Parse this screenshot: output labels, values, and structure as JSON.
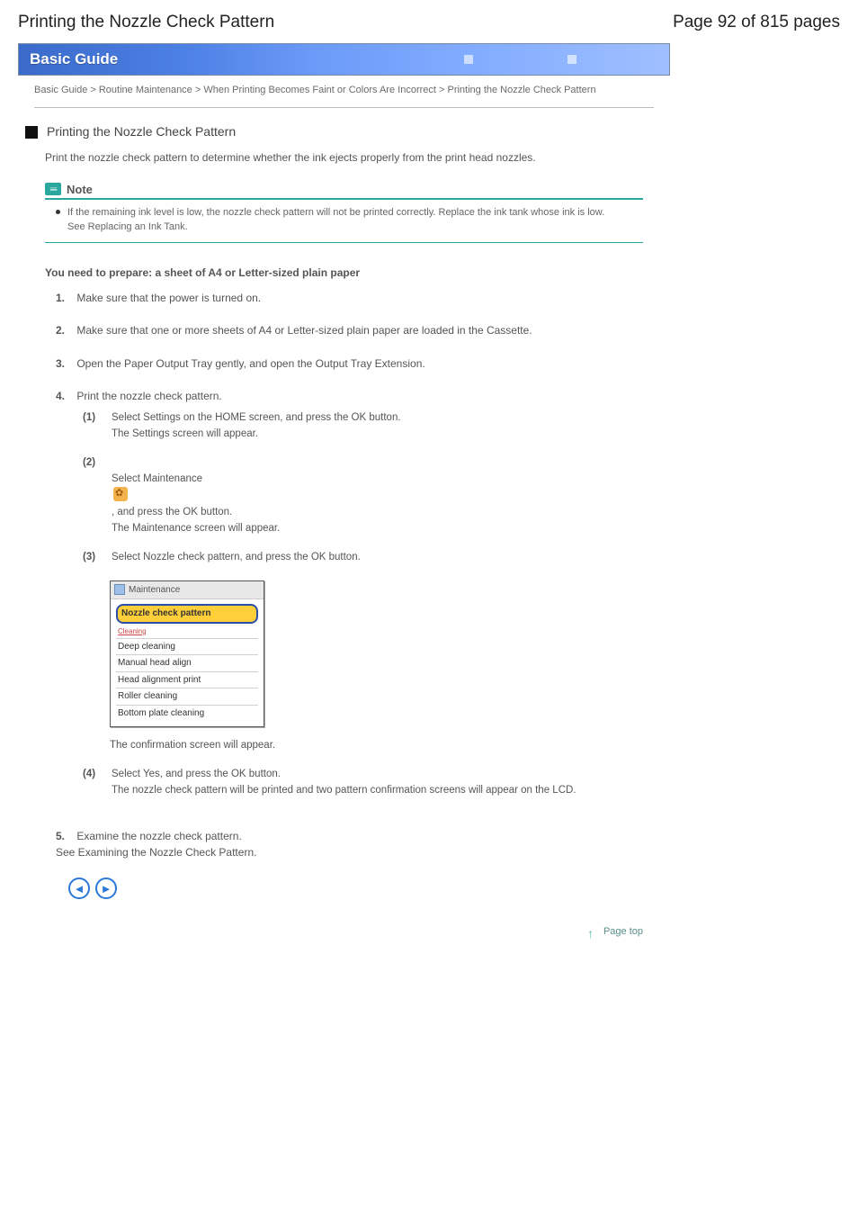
{
  "header": {
    "title_left": "Printing the Nozzle Check Pattern",
    "title_right": "Page 92 of 815 pages"
  },
  "banner": {
    "label": "Basic Guide"
  },
  "breadcrumb": "Basic Guide > Routine Maintenance > When Printing Becomes Faint or Colors Are Incorrect > Printing the Nozzle Check Pattern",
  "heading": "Printing the Nozzle Check Pattern",
  "intro": "Print the nozzle check pattern to determine whether the ink ejects properly from the print head nozzles.",
  "note": {
    "label": "Note",
    "body": "If the remaining ink level is low, the nozzle check pattern will not be printed correctly. Replace the ink tank whose ink is low.\nSee Replacing an Ink Tank."
  },
  "needs": "You need to prepare: a sheet of A4 or Letter-sized plain paper",
  "steps": {
    "s1": {
      "label": "1.",
      "text": "Make sure that the power is turned on."
    },
    "s2": {
      "label": "2.",
      "text": "Make sure that one or more sheets of A4 or Letter-sized plain paper are loaded in the Cassette."
    },
    "s3": {
      "label": "3.",
      "text": "Open the Paper Output Tray gently, and open the Output Tray Extension."
    },
    "s4": {
      "label": "4.",
      "text": "Print the nozzle check pattern.",
      "sub1_p": "(1)",
      "sub1_t": "Select Settings on the HOME screen, and press the OK button.\nThe Settings screen will appear.",
      "sub2_p": "(2)",
      "sub2_t_before": "Select Maintenance ",
      "sub2_t_after": ", and press the OK button.\nThe Maintenance screen will appear.",
      "sub3_p": "(3)",
      "sub3_t": "Select Nozzle check pattern, and press the OK button."
    },
    "lcd": {
      "title": "Maintenance",
      "items": [
        "Nozzle check pattern",
        "Cleaning",
        "Deep cleaning",
        "Manual head align",
        "Head alignment print",
        "Roller cleaning",
        "Bottom plate cleaning"
      ]
    },
    "after_lcd": "The confirmation screen will appear.",
    "sub4_p": "(4)",
    "sub4_t": "Select Yes, and press the OK button.\nThe nozzle check pattern will be printed and two pattern confirmation screens will appear on the LCD.",
    "s5": {
      "label": "5.",
      "text": "Examine the nozzle check pattern.\nSee Examining the Nozzle Check Pattern."
    }
  },
  "pagetop": "Page top"
}
